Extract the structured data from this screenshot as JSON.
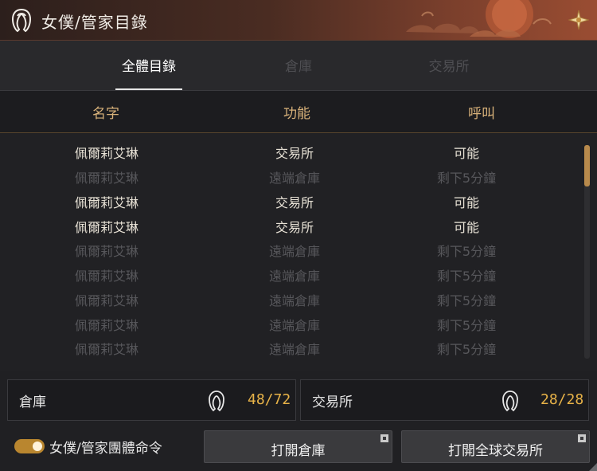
{
  "window": {
    "title": "女僕/管家目錄"
  },
  "tabs": [
    {
      "label": "全體目錄",
      "active": true
    },
    {
      "label": "倉庫",
      "active": false
    },
    {
      "label": "交易所",
      "active": false
    }
  ],
  "columns": {
    "name": "名字",
    "function": "功能",
    "call": "呼叫"
  },
  "rows": [
    {
      "name": "佩爾莉艾琳",
      "function": "交易所",
      "call": "可能",
      "available": true
    },
    {
      "name": "佩爾莉艾琳",
      "function": "遠端倉庫",
      "call": "剩下5分鐘",
      "available": false
    },
    {
      "name": "佩爾莉艾琳",
      "function": "交易所",
      "call": "可能",
      "available": true
    },
    {
      "name": "佩爾莉艾琳",
      "function": "交易所",
      "call": "可能",
      "available": true
    },
    {
      "name": "佩爾莉艾琳",
      "function": "遠端倉庫",
      "call": "剩下5分鐘",
      "available": false
    },
    {
      "name": "佩爾莉艾琳",
      "function": "遠端倉庫",
      "call": "剩下5分鐘",
      "available": false
    },
    {
      "name": "佩爾莉艾琳",
      "function": "遠端倉庫",
      "call": "剩下5分鐘",
      "available": false
    },
    {
      "name": "佩爾莉艾琳",
      "function": "遠端倉庫",
      "call": "剩下5分鐘",
      "available": false
    },
    {
      "name": "佩爾莉艾琳",
      "function": "遠端倉庫",
      "call": "剩下5分鐘",
      "available": false
    }
  ],
  "counters": {
    "warehouse": {
      "label": "倉庫",
      "count": "48/72",
      "icon": "maid-icon"
    },
    "market": {
      "label": "交易所",
      "count": "28/28",
      "icon": "maid-icon"
    }
  },
  "toggle": {
    "label": "女僕/管家團體命令",
    "on": true
  },
  "buttons": {
    "open_warehouse": "打開倉庫",
    "open_market": "打開全球交易所"
  },
  "colors": {
    "accent_gold": "#e8b348",
    "header_gold": "#d9b27a",
    "title_bar": "#7a3f2c",
    "scroll_thumb": "#b88a4c"
  }
}
